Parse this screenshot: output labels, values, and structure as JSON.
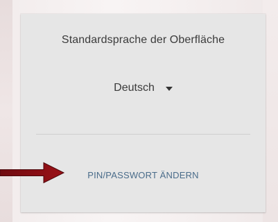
{
  "panel": {
    "title": "Standardsprache der Oberfläche",
    "language": {
      "selected": "Deutsch"
    },
    "change_pin_link": "PIN/PASSWORT ÄNDERN"
  },
  "annotation": {
    "arrow_color": "#8b0d12",
    "arrow_icon": "arrow-right-icon"
  }
}
